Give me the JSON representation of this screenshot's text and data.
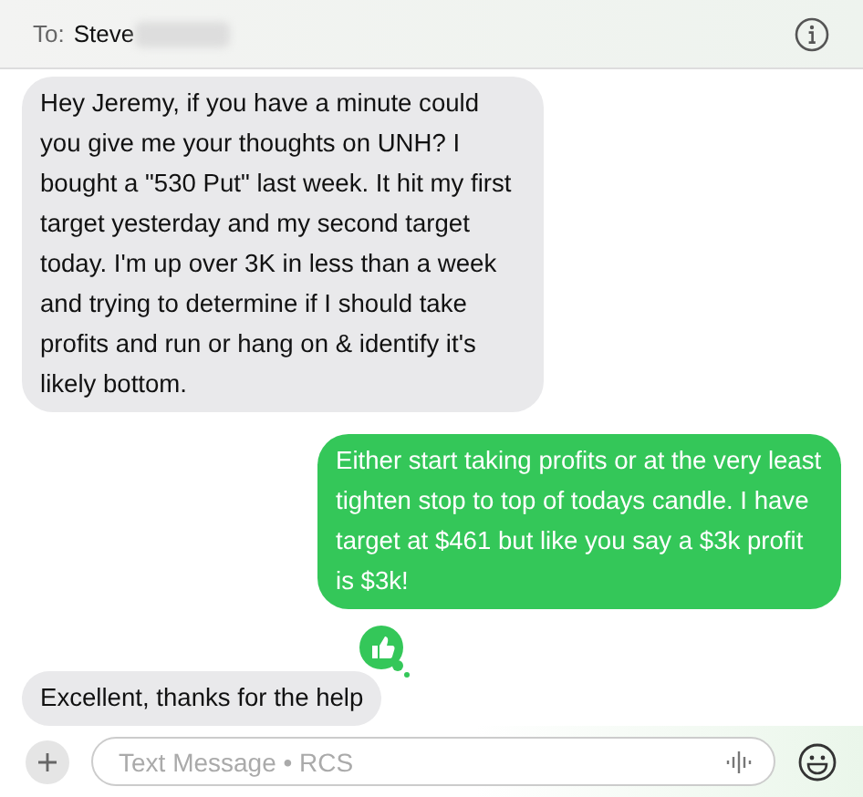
{
  "header": {
    "to_label": "To:",
    "recipient": "Steve"
  },
  "messages": [
    {
      "kind": "received",
      "text": "Hey Jeremy, if you have a minute could you give me your thoughts on UNH? I bought a \"530 Put\" last week. It hit my first target yesterday and my second target today. I'm up over 3K in less than a week and trying to determine if I should take profits and run or hang on & identify it's likely bottom.",
      "reaction": false
    },
    {
      "kind": "sent",
      "text": "Either start taking profits or at the very least tighten stop to top of todays candle.  I have target at $461 but like you say a $3k profit is $3k!",
      "reaction": false
    },
    {
      "kind": "received",
      "text": "Excellent, thanks for the help",
      "reaction": true
    }
  ],
  "composer": {
    "placeholder": "Text Message • RCS"
  }
}
